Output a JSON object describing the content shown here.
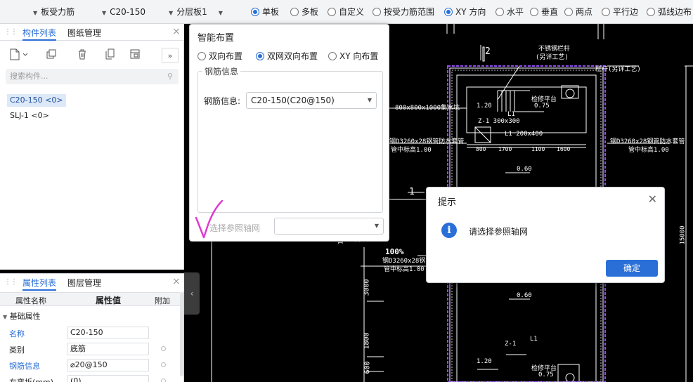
{
  "toolbar": {
    "category": "板受力筋",
    "component": "C20-150",
    "layer": "分层板1",
    "options": [
      {
        "label": "单板",
        "checked": true
      },
      {
        "label": "多板",
        "checked": false
      },
      {
        "label": "自定义",
        "checked": false
      },
      {
        "label": "按受力筋范围",
        "checked": false
      },
      {
        "label": "XY 方向",
        "checked": true
      },
      {
        "label": "水平",
        "checked": false
      },
      {
        "label": "垂直",
        "checked": false
      },
      {
        "label": "两点",
        "checked": false
      },
      {
        "label": "平行边",
        "checked": false
      },
      {
        "label": "弧线边布",
        "checked": false
      }
    ]
  },
  "component_panel": {
    "tabs": [
      "构件列表",
      "图纸管理"
    ],
    "search_placeholder": "搜索构件...",
    "items": [
      {
        "label": "C20-150 <0>",
        "selected": true
      },
      {
        "label": "SLJ-1 <0>",
        "selected": false
      }
    ]
  },
  "property_panel": {
    "tabs": [
      "属性列表",
      "图层管理"
    ],
    "headers": [
      "属性名称",
      "属性值",
      "附加"
    ],
    "group": "基础属性",
    "rows": [
      {
        "name": "名称",
        "value": "C20-150"
      },
      {
        "name": "类别",
        "value": "底筋"
      },
      {
        "name": "钢筋信息",
        "value": "⌀20@150"
      },
      {
        "name": "左弯折(mm)",
        "value": "(0)"
      }
    ]
  },
  "smart_layout": {
    "title": "智能布置",
    "options": [
      {
        "label": "双向布置",
        "checked": false
      },
      {
        "label": "双网双向布置",
        "checked": true
      },
      {
        "label": "XY 向布置",
        "checked": false
      }
    ],
    "group_label": "钢筋信息",
    "field_label": "钢筋信息:",
    "field_value": "C20-150(C20@150)",
    "axis_label": "选择参照轴网",
    "axis_value": ""
  },
  "prompt": {
    "title": "提示",
    "message": "请选择参照轴网",
    "ok": "确定"
  },
  "cad": {
    "labels": [
      "不锈钢栏杆",
      "(另详工艺)",
      "栏杆(另详工艺)",
      "2",
      "1",
      "800x800x1000集水坑",
      "1.20",
      "Z-1 300x300",
      "L1 200x400",
      "1700",
      "1100",
      "1600",
      "800",
      "0.60",
      "0.75",
      "L1",
      "检修平台",
      "钢D3260x28钢管防水套管",
      "管中标高1.00",
      "100%",
      "3000",
      "1800",
      "600",
      "16",
      "1",
      "Z-1",
      "15000"
    ]
  },
  "colors": {
    "accent": "#2a6fd8",
    "boundary": "#8e4cf0",
    "cad_line": "#ffffff",
    "annotation_check": "#e03ad0"
  }
}
